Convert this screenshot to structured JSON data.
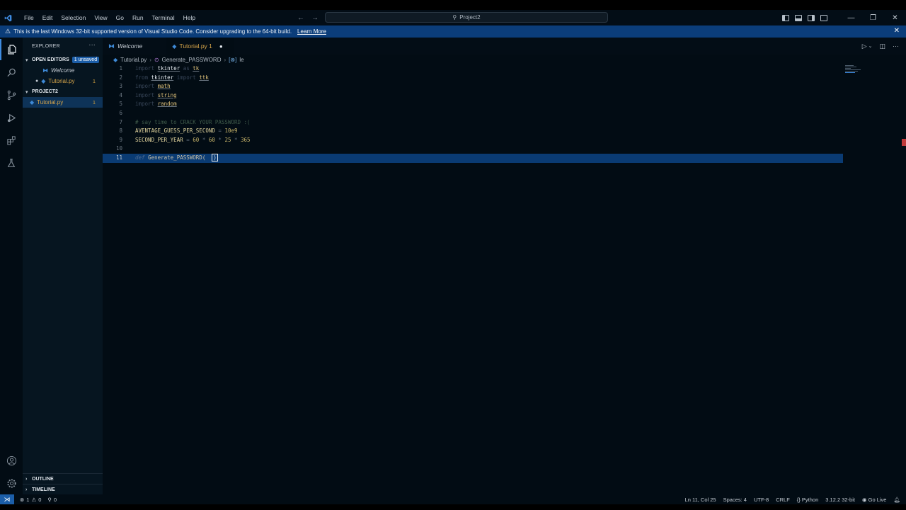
{
  "menu": [
    "File",
    "Edit",
    "Selection",
    "View",
    "Go",
    "Run",
    "Terminal",
    "Help"
  ],
  "command_center": "Project2",
  "window_controls": {
    "minimize": "—",
    "restore": "❐",
    "close": "✕"
  },
  "banner": {
    "message": "This is the last Windows 32-bit supported version of Visual Studio Code. Consider upgrading to the 64-bit build.",
    "link": "Learn More"
  },
  "sidebar": {
    "title": "EXPLORER",
    "open_editors": {
      "label": "OPEN EDITORS",
      "badge": "1 unsaved",
      "items": [
        {
          "name": "Welcome"
        },
        {
          "name": "Tutorial.py",
          "count": "1"
        }
      ]
    },
    "project": {
      "label": "PROJECT2",
      "items": [
        {
          "name": "Tutorial.py",
          "count": "1"
        }
      ]
    },
    "outline": "OUTLINE",
    "timeline": "TIMELINE"
  },
  "tabs": [
    {
      "label": "Welcome"
    },
    {
      "label": "Tutorial.py 1"
    }
  ],
  "breadcrumb": {
    "file": "Tutorial.py",
    "symbol": "Generate_PASSWORD",
    "sub": "le"
  },
  "code": {
    "line_numbers": [
      "1",
      "2",
      "3",
      "4",
      "5",
      "6",
      "7",
      "8",
      "9",
      "10",
      "11"
    ],
    "l1": {
      "kw": "import",
      "mod": "tkinter",
      "as": "as",
      "alias": "tk"
    },
    "l2": {
      "kw": "from",
      "mod": "tkinter",
      "imp": "import",
      "name": "ttk"
    },
    "l3": {
      "kw": "import",
      "mod": "math"
    },
    "l4": {
      "kw": "import",
      "mod": "string"
    },
    "l5": {
      "kw": "import",
      "mod": "random"
    },
    "l7": "# say time to CRACK YOUR PASSWORD :(",
    "l8": {
      "name": "AVENTAGE_GUESS_PER_SECOND",
      "eq": "=",
      "val": "10e9"
    },
    "l9": {
      "name": "SECOND_PER_YEAR",
      "eq": "=",
      "a": "60",
      "x": "*",
      "b": "60",
      "c": "25",
      "d": "365"
    },
    "l11": {
      "kw": "def",
      "fn": "Generate_PASSWORD(",
      "cursor": ")"
    }
  },
  "status": {
    "errors": "1",
    "warnings": "0",
    "ports": "0",
    "position": "Ln 11, Col 25",
    "spaces": "Spaces: 4",
    "encoding": "UTF-8",
    "eol": "CRLF",
    "language": "Python",
    "interpreter": "3.12.2 32-bit",
    "golive": "Go Live"
  }
}
